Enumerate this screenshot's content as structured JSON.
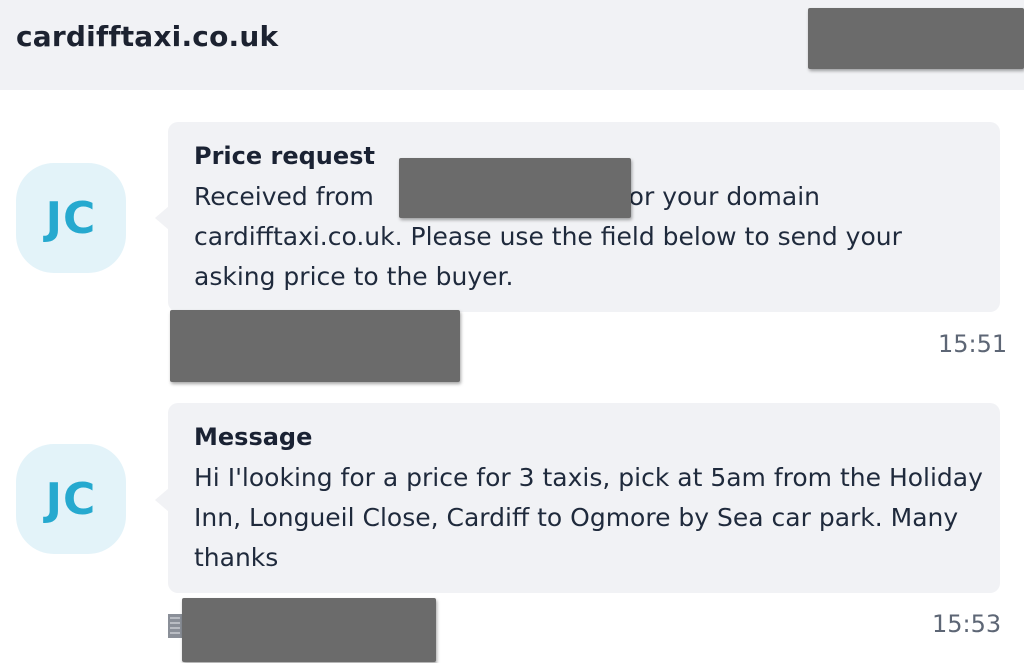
{
  "header": {
    "domain": "cardifftaxi.co.uk"
  },
  "messages": [
    {
      "avatar_initials": "JC",
      "title": "Price request",
      "text_before": "Received from",
      "text_after_line1": "for your domain",
      "text_rest": "cardifftaxi.co.uk. Please use the field below to send your asking price to the buyer.",
      "time": "15:51"
    },
    {
      "avatar_initials": "JC",
      "title": "Message",
      "text": "Hi I'looking for a price for 3 taxis, pick at 5am from the Holiday Inn, Longueil Close, Cardiff to Ogmore by Sea car park. Many thanks",
      "time": "15:53"
    }
  ],
  "colors": {
    "accent": "#26a9cf",
    "avatar_bg": "#e3f3f9",
    "bubble_bg": "#f1f2f5",
    "redaction": "#6b6b6b"
  },
  "icons": {
    "sender_icon": "building-icon"
  }
}
